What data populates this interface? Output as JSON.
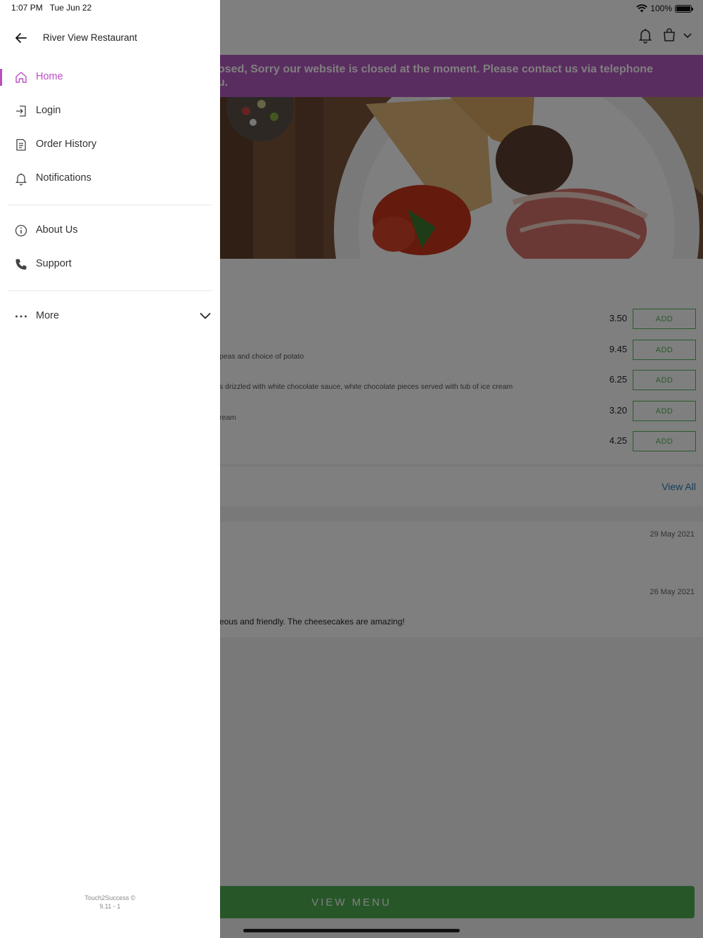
{
  "status_bar": {
    "time": "1:07 PM",
    "date": "Tue Jun 22",
    "battery": "100%",
    "battery_level": 1.0
  },
  "banner": {
    "line1": "osed, Sorry our website is closed at the moment. Please contact us via telephone",
    "line2": "u."
  },
  "menu_items": [
    {
      "desc": "",
      "price": "3.50",
      "add_label": "ADD"
    },
    {
      "desc": "peas and choice of potato",
      "price": "9.45",
      "add_label": "ADD"
    },
    {
      "desc": "s drizzled with white chocolate sauce, white chocolate pieces served with tub of ice cream",
      "price": "6.25",
      "add_label": "ADD"
    },
    {
      "desc": "ream",
      "price": "3.20",
      "add_label": "ADD"
    },
    {
      "desc": "",
      "price": "4.25",
      "add_label": "ADD"
    }
  ],
  "reviews": {
    "view_all": "View All",
    "items": [
      {
        "date": "29 May 2021",
        "text": ""
      },
      {
        "date": "26 May 2021",
        "text": "eous and friendly. The cheesecakes are amazing!"
      }
    ]
  },
  "view_menu_label": "VIEW MENU",
  "drawer": {
    "restaurant_name": "River View Restaurant",
    "nav_primary": [
      {
        "label": "Home",
        "icon": "home-icon",
        "active": true
      },
      {
        "label": "Login",
        "icon": "login-icon"
      },
      {
        "label": "Order History",
        "icon": "order-history-icon"
      },
      {
        "label": "Notifications",
        "icon": "bell-icon"
      }
    ],
    "nav_secondary": [
      {
        "label": "About Us",
        "icon": "info-icon"
      },
      {
        "label": "Support",
        "icon": "phone-icon"
      }
    ],
    "more_label": "More",
    "footer_brand": "Touch2Success ©",
    "footer_version": "9.11 - 1"
  },
  "colors": {
    "accent": "#b94ec1",
    "banner": "#b45ac0",
    "green": "#4fae53",
    "link": "#2a7db5"
  }
}
